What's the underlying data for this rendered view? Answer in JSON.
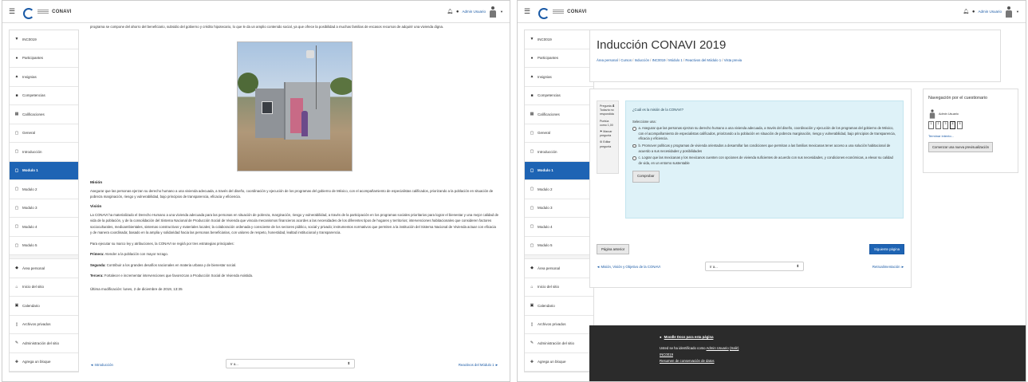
{
  "brand": {
    "name": "CONAVI"
  },
  "topbar": {
    "user_name": "Admin Usuario"
  },
  "sidebar": {
    "items": [
      {
        "label": "INC0019",
        "icon": "cap-icon"
      },
      {
        "label": "Participantes",
        "icon": "users-icon"
      },
      {
        "label": "Insignias",
        "icon": "badge-icon"
      },
      {
        "label": "Competencias",
        "icon": "check-square-icon"
      },
      {
        "label": "Calificaciones",
        "icon": "table-icon"
      },
      {
        "label": "General",
        "icon": "folder-icon"
      },
      {
        "label": "Introducción",
        "icon": "folder-icon"
      },
      {
        "label": "Modulo 1",
        "icon": "folder-icon",
        "active": true
      },
      {
        "label": "Modulo 2",
        "icon": "folder-icon"
      },
      {
        "label": "Modulo 3",
        "icon": "folder-icon"
      },
      {
        "label": "Modulo 4",
        "icon": "folder-icon"
      },
      {
        "label": "Modulo 5",
        "icon": "folder-icon"
      },
      {
        "label": "Área personal",
        "icon": "dashboard-icon"
      },
      {
        "label": "Inicio del sitio",
        "icon": "home-icon"
      },
      {
        "label": "Calendario",
        "icon": "calendar-icon"
      },
      {
        "label": "Archivos privados",
        "icon": "file-icon"
      },
      {
        "label": "Administración del sitio",
        "icon": "wrench-icon"
      },
      {
        "label": "Agrega un bloque",
        "icon": "plus-icon"
      }
    ]
  },
  "left": {
    "intro": "programa se compone del ahorro del beneficiario, subsidio del gobierno y crédito hipotecario, lo que le da un amplio contenido social, ya que ofrece la posibilidad a muchas familias de escasos recursos de adquirir una vivienda digna.",
    "mision_heading": "Misión",
    "mision_text": "Asegurar que las personas ejerzan su derecho humano a una vivienda adecuada, a través del diseño, coordinación y ejecución de los programas del gobierno de México, con el acompañamiento de especialistas calificados, priorizando a la población en situación de pobreza marginación, riesgo y vulnerabilidad, bajo principios de transparencia, eficacia y eficiencia.",
    "vision_heading": "Visión",
    "vision_text": "La CONAVI ha materializado el Derecho Humano a una vivienda adecuada para las personas en situación de pobreza, marginación, riesgo y vulnerabilidad, a través de la participación en los programas sociales prioritarios para lograr el bienestar y una mejor calidad de vida de la población, y de la consolidación del Sistema Nacional de Producción Social de Vivienda que vincula mecanismos financieros acordes a las necesidades de los diferentes tipos de hogares y territorios; intervenciones habitacionales que consideren factores socioculturales, medioambientales, sistemas constructivos y materiales locales; la colaboración ordenada y consciente de los sectores público, social y privado; instrumentos normativos que permiten a la institución del Sistema Nacional de Vivienda actuar con eficacia y de manera coordinada; basado en la amplia y solidaridad hacia las personas beneficiarias, con valores de respeto, honestidad, lealtad institucional y transparencia.",
    "para_text": "Para ejecutar su marco ley y atribuciones, la CONAVI se regirá por tres estrategias principales:",
    "primera_label": "Primera:",
    "primera_text": "Atender a la población con mayor rezago.",
    "segunda_label": "Segunda:",
    "segunda_text": "Contribuir a los grandes desafíos nacionales en materia urbana y de bienestar social.",
    "tercera_label": "Tercera:",
    "tercera_text": "Fortalecer e incrementar intervenciones que favorezcan a Producción Social de Vivienda Asistida.",
    "last_modified": "Última modificación: lunes, 2 de diciembre de 2019, 13:35",
    "prev_link": "◄ Introducción",
    "jump_value": "Ir a...",
    "next_link": "Reactivos del Módulo 1 ►"
  },
  "right": {
    "title": "Inducción CONAVI 2019",
    "breadcrumb": [
      "Área personal",
      "Cursos",
      "Inducción",
      "INC0019",
      "Módulo 1",
      "Reactivos del Módulo 1",
      "Vista previa"
    ],
    "qinfo": {
      "label": "Pregunta",
      "number": "4",
      "status": "Todavía no respondida",
      "points": "Puntúa como 1,00",
      "flag": "Marcar pregunta",
      "edit": "Editar pregunta"
    },
    "question": "¿Cuál es la misión de la CONAVI?",
    "select_one": "Seleccione una:",
    "options": [
      "a. Asegurar que las personas ejerzan su derecho humano a una vivienda adecuada, a través del diseño, coordinación y ejecución de los programas del gobierno de México, con el acompañamiento de especialistas calificados, priorizando a la población en situación de pobreza marginación, riesgo y vulnerabilidad, bajo principios de transparencia, eficacia y eficiencia.",
      "b. Promover políticas y programas de vivienda orientados a desarrollar las condiciones que permitan a las familias mexicanas tener acceso a una solución habitacional de acuerdo a sus necesidades y posibilidades",
      "c. Lograr que las mexicanas y los mexicanos cuenten con opciones de vivienda suficientes de acuerdo con sus necesidades, y condiciones económicas, a elevar su calidad de vida, en un entorno sustentable"
    ],
    "check_button": "Comprobar",
    "prev_page": "Página anterior",
    "next_page": "Siguiente página",
    "prev_link": "◄ Misión, Visión y Objetivo de la CONAVI",
    "jump_value": "Ir a...",
    "next_link": "Retroalimentación ►",
    "quiz_nav": {
      "title": "Navegación por el cuestionario",
      "user": "Admin Usuario",
      "boxes": [
        "1",
        "2",
        "3",
        "4",
        "5"
      ],
      "current_index": 3,
      "finish": "Terminar intento...",
      "new_preview": "Comenzar una nueva previsualización"
    },
    "footer": {
      "docs": "Moodle Docs para esta página",
      "identified_prefix": "Usted se ha identificado como",
      "identified_user": "Admin Usuario",
      "logout": "(Salir)",
      "course": "INC0019",
      "retention": "Resumen de conservación de datos"
    }
  }
}
